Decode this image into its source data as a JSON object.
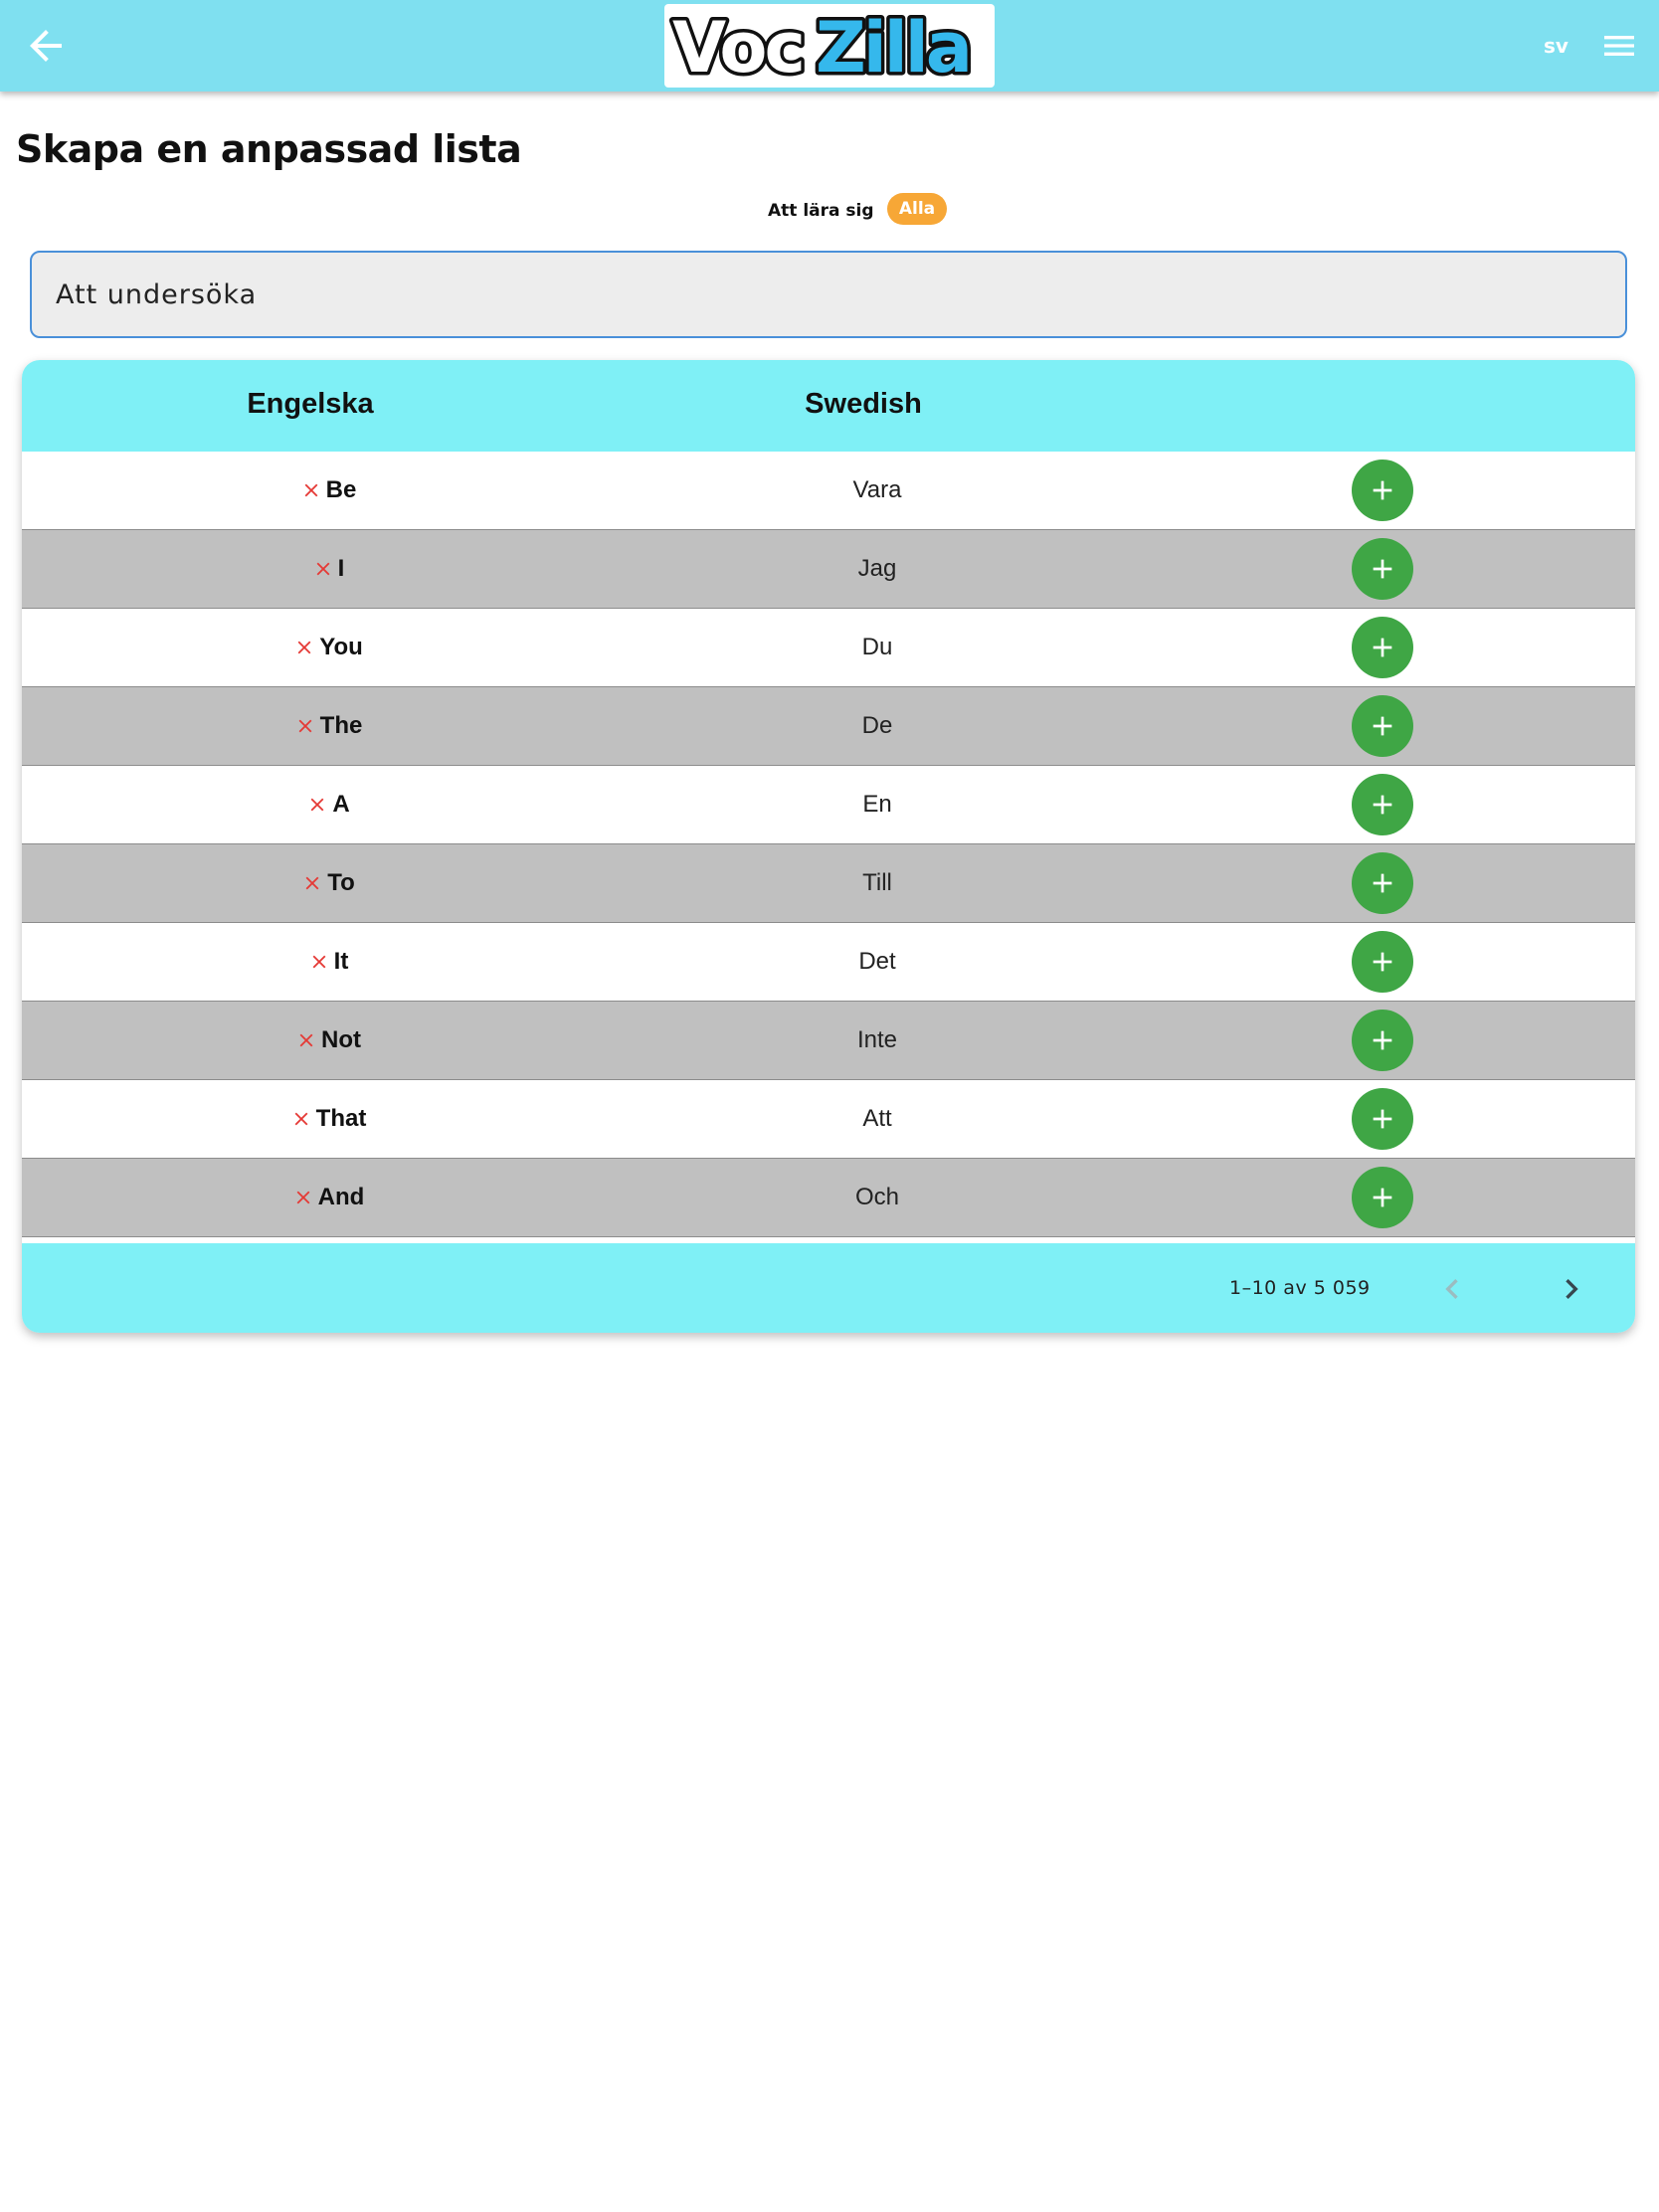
{
  "header": {
    "logo_text_left": "Voc",
    "logo_text_right": "Zilla",
    "language": "sv",
    "icons": {
      "back": "arrow-left-icon",
      "menu": "hamburger-menu-icon"
    }
  },
  "page": {
    "title": "Skapa en anpassad lista"
  },
  "filter": {
    "label": "Att lära sig",
    "selected_chip": "Alla"
  },
  "search": {
    "placeholder": "Att undersöka",
    "value": ""
  },
  "table": {
    "columns": [
      "Engelska",
      "Swedish"
    ],
    "rows": [
      {
        "english": "Be",
        "swedish": "Vara"
      },
      {
        "english": "I",
        "swedish": "Jag"
      },
      {
        "english": "You",
        "swedish": "Du"
      },
      {
        "english": "The",
        "swedish": "De"
      },
      {
        "english": "A",
        "swedish": "En"
      },
      {
        "english": "To",
        "swedish": "Till"
      },
      {
        "english": "It",
        "swedish": "Det"
      },
      {
        "english": "Not",
        "swedish": "Inte"
      },
      {
        "english": "That",
        "swedish": "Att"
      },
      {
        "english": "And",
        "swedish": "Och"
      }
    ],
    "row_icons": {
      "status": "close-icon",
      "action": "plus-icon"
    }
  },
  "pagination": {
    "range": "1–10 av 5 059",
    "icons": {
      "prev": "chevron-left-icon",
      "next": "chevron-right-icon"
    }
  },
  "colors": {
    "header_bg": "#7fe0f0",
    "table_header_bg": "#7ff0f6",
    "chip": "#f7a736",
    "add_button": "#3fa645",
    "remove_icon": "#e53935",
    "alt_row": "#c0c0c0"
  }
}
